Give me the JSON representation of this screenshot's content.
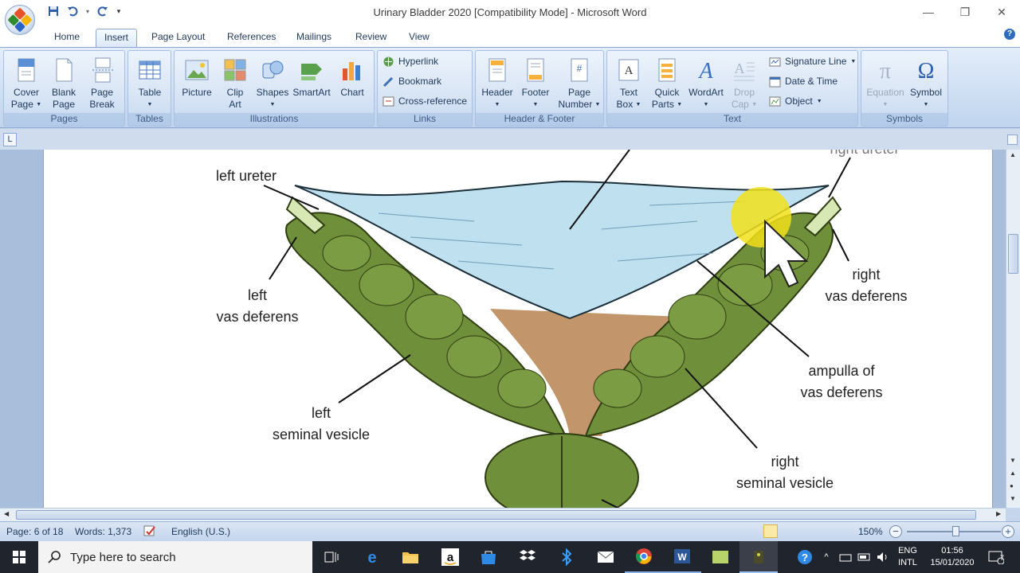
{
  "window": {
    "title": "Urinary Bladder 2020 [Compatibility Mode] - Microsoft Word",
    "minimize": "—",
    "restore": "❐",
    "close": "✕"
  },
  "qat": {
    "save_icon": "save-icon",
    "undo_icon": "undo-icon",
    "redo_icon": "redo-icon",
    "customize_icon": "customize-icon"
  },
  "tabs": [
    "Home",
    "Insert",
    "Page Layout",
    "References",
    "Mailings",
    "Review",
    "View"
  ],
  "active_tab": "Insert",
  "ribbon": {
    "pages": {
      "label": "Pages",
      "cover_page": "Cover",
      "cover_page2": "Page",
      "blank_page": "Blank",
      "blank_page2": "Page",
      "page_break": "Page",
      "page_break2": "Break"
    },
    "tables": {
      "label": "Tables",
      "table": "Table"
    },
    "illustrations": {
      "label": "Illustrations",
      "picture": "Picture",
      "clip_art": "Clip",
      "clip_art2": "Art",
      "shapes": "Shapes",
      "smartart": "SmartArt",
      "chart": "Chart"
    },
    "links": {
      "label": "Links",
      "hyperlink": "Hyperlink",
      "bookmark": "Bookmark",
      "cross_reference": "Cross-reference"
    },
    "header_footer": {
      "label": "Header & Footer",
      "header": "Header",
      "footer": "Footer",
      "page_number": "Page",
      "page_number2": "Number"
    },
    "text": {
      "label": "Text",
      "text_box": "Text",
      "text_box2": "Box",
      "quick_parts": "Quick",
      "quick_parts2": "Parts",
      "wordart": "WordArt",
      "drop_cap": "Drop",
      "drop_cap2": "Cap",
      "signature_line": "Signature Line",
      "date_time": "Date & Time",
      "object": "Object"
    },
    "symbols": {
      "label": "Symbols",
      "equation": "Equation",
      "symbol": "Symbol"
    }
  },
  "diagram": {
    "labels": {
      "left_ureter": "left ureter",
      "right_ureter": "right ureter",
      "left_vas_1": "left",
      "left_vas_2": "vas deferens",
      "right_vas_1": "right",
      "right_vas_2": "vas deferens",
      "ampulla_1": "ampulla of",
      "ampulla_2": "vas deferens",
      "left_sv_1": "left",
      "left_sv_2": "seminal vesicle",
      "right_sv_1": "right",
      "right_sv_2": "seminal vesicle"
    }
  },
  "status": {
    "page": "Page: 6 of 18",
    "words": "Words: 1,373",
    "language": "English (U.S.)",
    "zoom": "150%",
    "zoom_out": "−",
    "zoom_in": "+"
  },
  "taskbar": {
    "search_placeholder": "Type here to search",
    "lang_1": "ENG",
    "lang_2": "INTL",
    "time": "01:56",
    "date": "15/01/2020",
    "notifications": "7"
  }
}
